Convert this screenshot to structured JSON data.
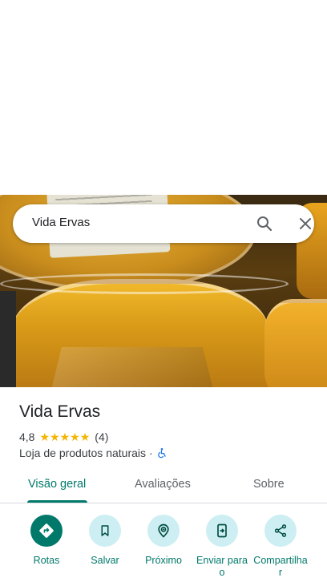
{
  "search": {
    "query": "Vida Ervas"
  },
  "place": {
    "name": "Vida Ervas",
    "rating": "4,8",
    "stars": 5,
    "review_count": "(4)",
    "category": "Loja de produtos naturais",
    "separator": "·"
  },
  "tabs": [
    {
      "label": "Visão geral",
      "active": true
    },
    {
      "label": "Avaliações",
      "active": false
    },
    {
      "label": "Sobre",
      "active": false
    }
  ],
  "actions": [
    {
      "label": "Rotas",
      "icon": "directions-icon"
    },
    {
      "label": "Salvar",
      "icon": "bookmark-icon"
    },
    {
      "label": "Próximo",
      "icon": "nearby-icon"
    },
    {
      "label": "Enviar para o",
      "icon": "send-to-phone-icon"
    },
    {
      "label": "Compartilhar",
      "icon": "share-icon"
    }
  ],
  "colors": {
    "accent": "#00796b",
    "accent_light": "#cdeef2",
    "star": "#f5b400",
    "accessibility": "#1a73e8"
  }
}
